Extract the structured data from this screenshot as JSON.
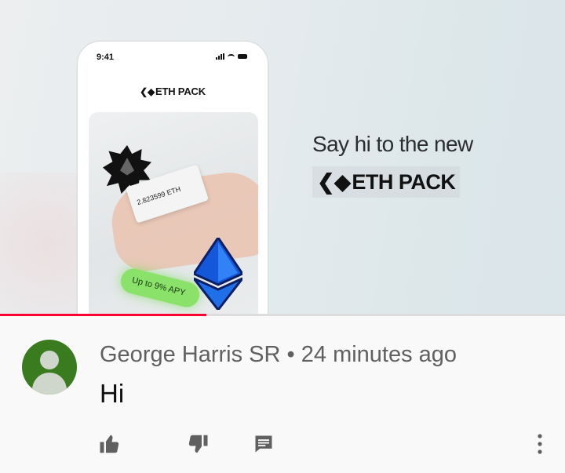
{
  "ad": {
    "phone_time": "9:41",
    "phone_brand": "ETH PACK",
    "eth_amount": "2.823599 ETH",
    "apy_label": "Up to 9% APY",
    "tagline": "Say hi to the new",
    "brand": "ETH PACK"
  },
  "progress": {
    "percent": 36.5,
    "color": "#ff0033"
  },
  "comment": {
    "author": "George Harris SR",
    "separator": "•",
    "time": "24 minutes ago",
    "text": "Hi",
    "avatar_color": "#3b7b1f"
  },
  "icons": {
    "like": "thumbs-up-icon",
    "dislike": "thumbs-down-icon",
    "reply": "comment-icon",
    "more": "more-vertical-icon"
  }
}
